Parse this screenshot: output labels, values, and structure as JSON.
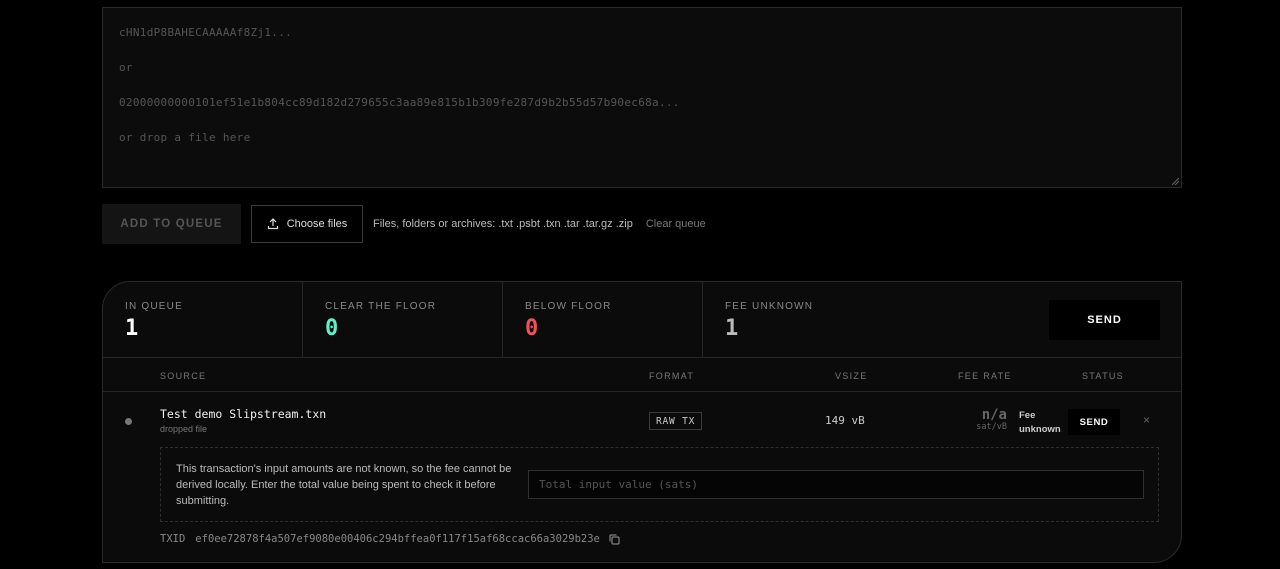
{
  "input": {
    "placeholder_lines": [
      "cHN1dP8BAHECAAAAAf8Zj1...",
      "or",
      "02000000000101ef51e1b804cc89d182d279655c3aa89e815b1b309fe287d9b2b55d57b90ec68a...",
      "or drop a file here"
    ]
  },
  "actions": {
    "add_to_queue": "ADD TO QUEUE",
    "choose_files": "Choose files",
    "hint": "Files, folders or archives: .txt .psbt .txn .tar .tar.gz .zip",
    "clear_queue": "Clear queue"
  },
  "stats": [
    {
      "label": "IN QUEUE",
      "value": "1",
      "color": "#ffffff"
    },
    {
      "label": "CLEAR THE FLOOR",
      "value": "0",
      "color": "#5ef0c8"
    },
    {
      "label": "BELOW FLOOR",
      "value": "0",
      "color": "#f0505a"
    },
    {
      "label": "FEE UNKNOWN",
      "value": "1",
      "color": "#bbbbbb"
    }
  ],
  "send_label": "SEND",
  "columns": {
    "source": "SOURCE",
    "format": "FORMAT",
    "vsize": "VSIZE",
    "fee_rate": "FEE RATE",
    "status": "STATUS"
  },
  "row": {
    "name": "Test demo Slipstream.txn",
    "sub": "dropped file",
    "format": "RAW TX",
    "vsize": "149 vB",
    "fee_rate": "n/a",
    "fee_unit": "sat/vB",
    "status_line1": "Fee",
    "status_line2": "unknown",
    "send": "SEND",
    "remove": "×",
    "note": "This transaction's input amounts are not known, so the fee cannot be derived locally. Enter the total value being spent to check it before submitting.",
    "input_placeholder": "Total input value (sats)",
    "txid_label": "TXID",
    "txid": "ef0ee72878f4a507ef9080e00406c294bffea0f117f15af68ccac66a3029b23e"
  }
}
